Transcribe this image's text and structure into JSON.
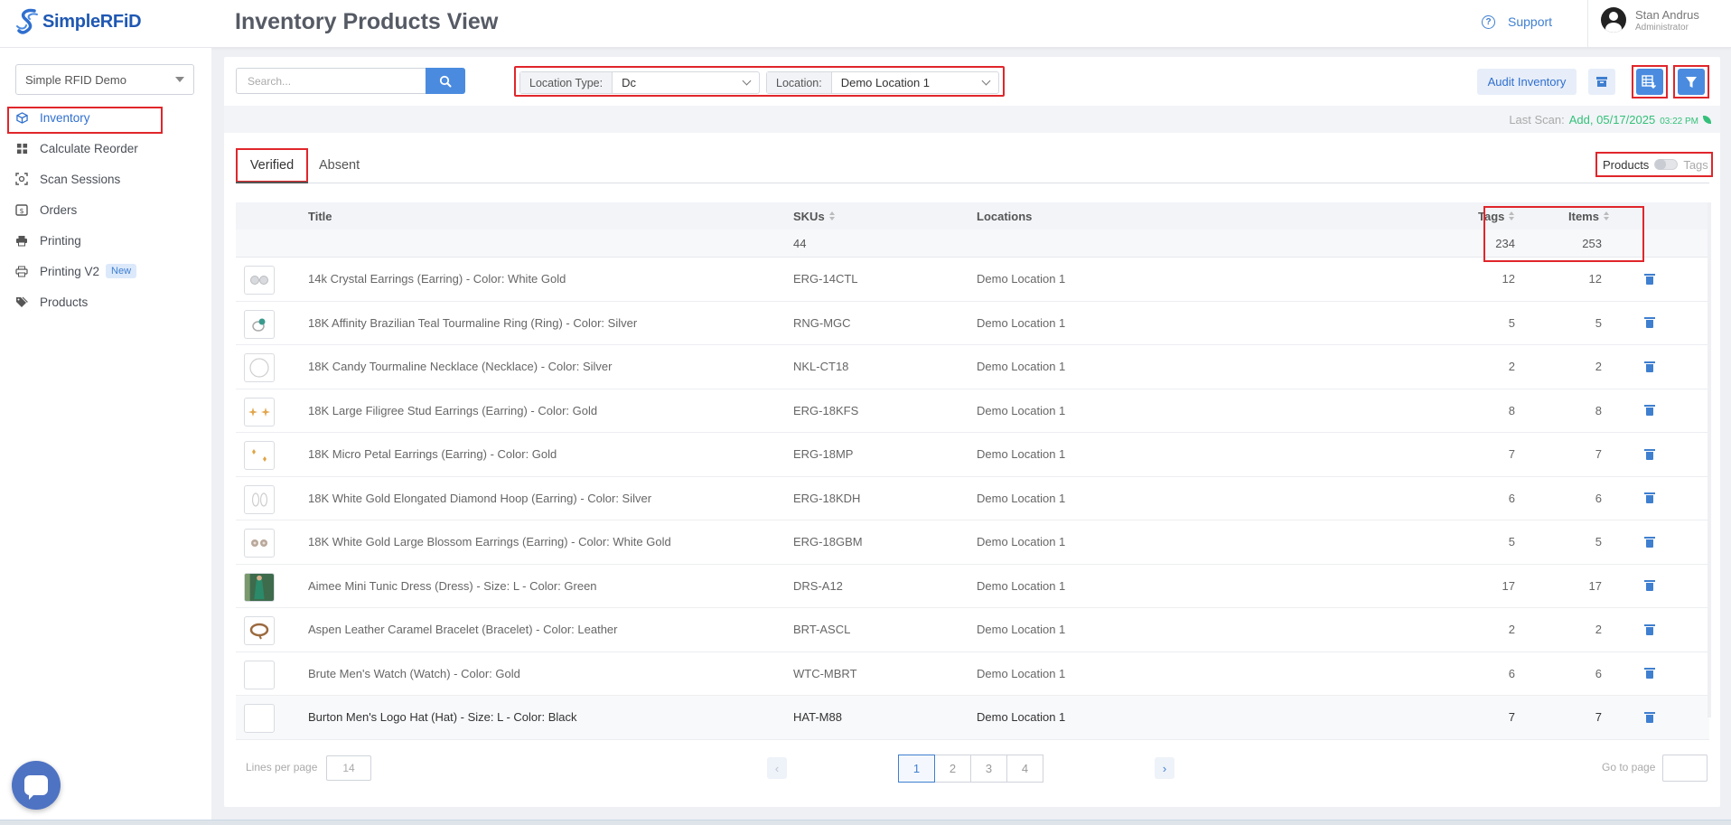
{
  "brand": {
    "name_prefix": "Simple",
    "name_suffix": "RFiD"
  },
  "header": {
    "title": "Inventory Products View",
    "support_label": "Support",
    "user_name": "Stan Andrus",
    "user_role": "Administrator"
  },
  "sidebar": {
    "org_selected": "Simple RFID Demo",
    "items": [
      {
        "label": "Inventory",
        "icon": "cube-icon",
        "active": true
      },
      {
        "label": "Calculate Reorder",
        "icon": "grid-icon"
      },
      {
        "label": "Scan Sessions",
        "icon": "scan-icon"
      },
      {
        "label": "Orders",
        "icon": "dollar-box-icon"
      },
      {
        "label": "Printing",
        "icon": "printer-icon"
      },
      {
        "label": "Printing V2",
        "icon": "printer-icon",
        "badge": "New"
      },
      {
        "label": "Products",
        "icon": "tags-icon"
      }
    ]
  },
  "toolbar": {
    "search_placeholder": "Search...",
    "location_type_label": "Location Type:",
    "location_type_value": "Dc",
    "location_label": "Location:",
    "location_value": "Demo Location 1",
    "audit_label": "Audit Inventory"
  },
  "last_scan": {
    "label": "Last Scan:",
    "value": "Add, 05/17/2025",
    "time": "03:22 PM"
  },
  "tabs": {
    "verified": "Verified",
    "absent": "Absent"
  },
  "view_toggle": {
    "products": "Products",
    "tags": "Tags"
  },
  "table": {
    "headers": {
      "title": "Title",
      "skus": "SKUs",
      "locations": "Locations",
      "tags": "Tags",
      "items": "Items"
    },
    "totals": {
      "skus": "44",
      "tags": "234",
      "items": "253"
    },
    "rows": [
      {
        "title": "14k Crystal Earrings (Earring) - Color: White Gold",
        "sku": "ERG-14CTL",
        "location": "Demo Location 1",
        "tags": "12",
        "items": "12",
        "thumb": "earring-white"
      },
      {
        "title": "18K Affinity Brazilian Teal Tourmaline Ring (Ring) - Color: Silver",
        "sku": "RNG-MGC",
        "location": "Demo Location 1",
        "tags": "5",
        "items": "5",
        "thumb": "ring-teal"
      },
      {
        "title": "18K Candy Tourmaline Necklace (Necklace) - Color: Silver",
        "sku": "NKL-CT18",
        "location": "Demo Location 1",
        "tags": "2",
        "items": "2",
        "thumb": "necklace"
      },
      {
        "title": "18K Large Filigree Stud Earrings (Earring) - Color: Gold",
        "sku": "ERG-18KFS",
        "location": "Demo Location 1",
        "tags": "8",
        "items": "8",
        "thumb": "stud-gold"
      },
      {
        "title": "18K Micro Petal Earrings (Earring) - Color: Gold",
        "sku": "ERG-18MP",
        "location": "Demo Location 1",
        "tags": "7",
        "items": "7",
        "thumb": "petal-gold"
      },
      {
        "title": "18K White Gold Elongated Diamond Hoop (Earring) - Color: Silver",
        "sku": "ERG-18KDH",
        "location": "Demo Location 1",
        "tags": "6",
        "items": "6",
        "thumb": "hoop"
      },
      {
        "title": "18K White Gold Large Blossom Earrings (Earring) - Color: White Gold",
        "sku": "ERG-18GBM",
        "location": "Demo Location 1",
        "tags": "5",
        "items": "5",
        "thumb": "blossom"
      },
      {
        "title": "Aimee Mini Tunic Dress (Dress) - Size: L - Color: Green",
        "sku": "DRS-A12",
        "location": "Demo Location 1",
        "tags": "17",
        "items": "17",
        "thumb": "dress"
      },
      {
        "title": "Aspen Leather Caramel Bracelet (Bracelet) - Color: Leather",
        "sku": "BRT-ASCL",
        "location": "Demo Location 1",
        "tags": "2",
        "items": "2",
        "thumb": "bracelet"
      },
      {
        "title": "Brute Men's Watch (Watch) - Color: Gold",
        "sku": "WTC-MBRT",
        "location": "Demo Location 1",
        "tags": "6",
        "items": "6",
        "thumb": "blank"
      },
      {
        "title": "Burton Men's Logo Hat (Hat) - Size: L - Color: Black",
        "sku": "HAT-M88",
        "location": "Demo Location 1",
        "tags": "7",
        "items": "7",
        "thumb": "blank"
      }
    ]
  },
  "pagination": {
    "lines_label": "Lines per page",
    "lines_value": "14",
    "pages": [
      "1",
      "2",
      "3",
      "4"
    ],
    "current": "1",
    "goto_label": "Go to page"
  }
}
